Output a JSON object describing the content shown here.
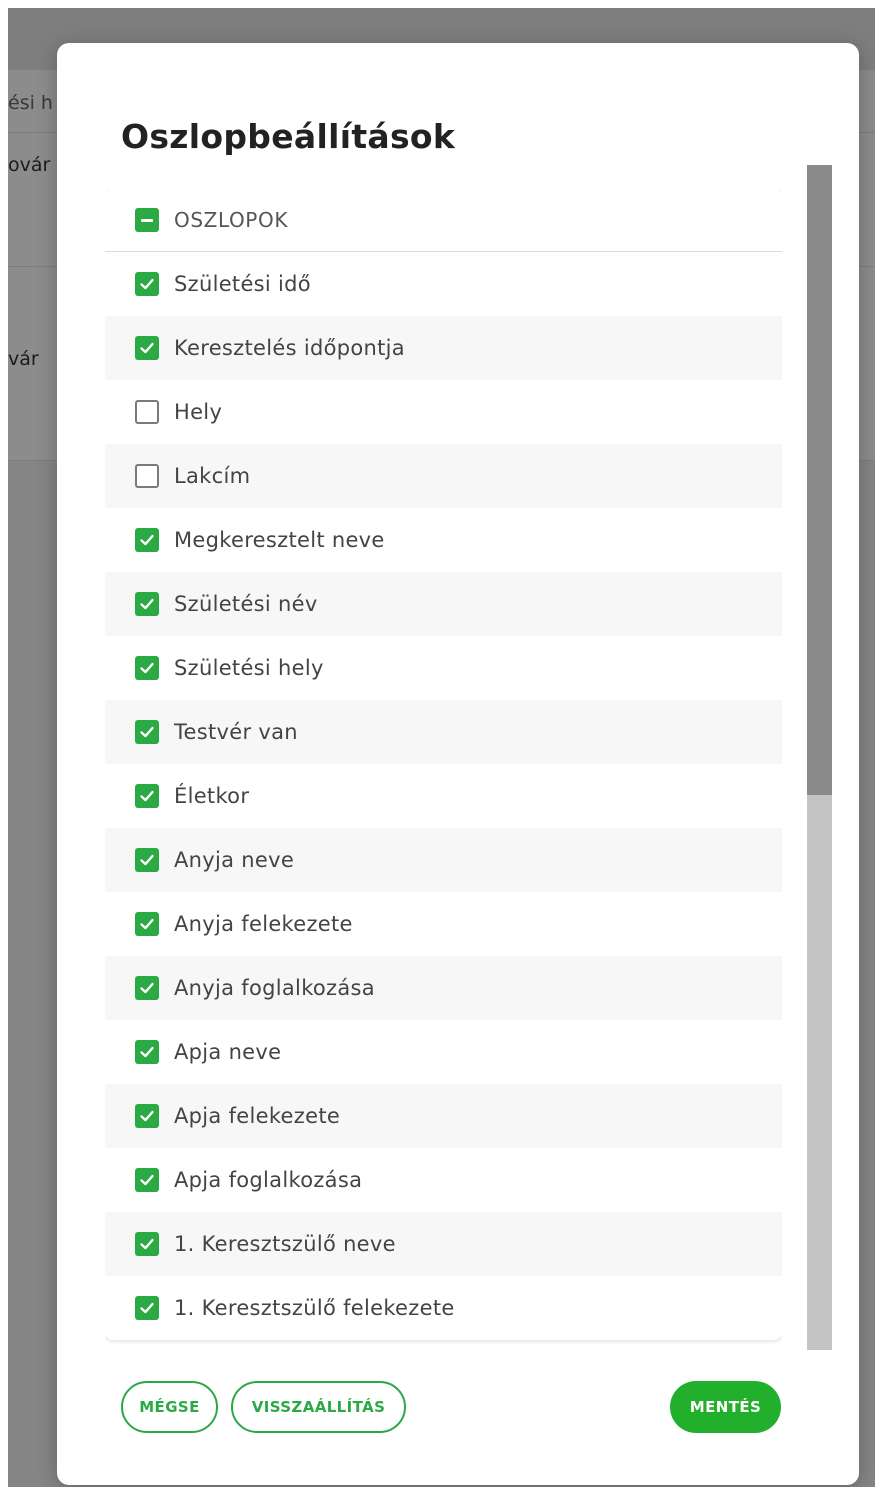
{
  "background": {
    "header_fragment": "ési h",
    "row_fragments": [
      "ovár",
      "vár"
    ]
  },
  "modal": {
    "title": "Oszlopbeállítások",
    "header": {
      "label": "OSZLOPOK",
      "state": "indeterminate"
    },
    "columns": [
      {
        "label": "Születési idő",
        "checked": true
      },
      {
        "label": "Keresztelés időpontja",
        "checked": true
      },
      {
        "label": "Hely",
        "checked": false
      },
      {
        "label": "Lakcím",
        "checked": false
      },
      {
        "label": "Megkeresztelt neve",
        "checked": true
      },
      {
        "label": "Születési név",
        "checked": true
      },
      {
        "label": "Születési hely",
        "checked": true
      },
      {
        "label": "Testvér van",
        "checked": true
      },
      {
        "label": "Életkor",
        "checked": true
      },
      {
        "label": "Anyja neve",
        "checked": true
      },
      {
        "label": "Anyja felekezete",
        "checked": true
      },
      {
        "label": "Anyja foglalkozása",
        "checked": true
      },
      {
        "label": "Apja neve",
        "checked": true
      },
      {
        "label": "Apja felekezete",
        "checked": true
      },
      {
        "label": "Apja foglalkozása",
        "checked": true
      },
      {
        "label": "1. Keresztszülő neve",
        "checked": true
      },
      {
        "label": "1. Keresztszülő felekezete",
        "checked": true
      }
    ],
    "buttons": {
      "cancel": "MÉGSE",
      "reset": "VISSZAÁLLÍTÁS",
      "save": "MENTÉS"
    }
  },
  "colors": {
    "accent": "#2ba944",
    "save_button": "#22b02c",
    "overlay": "rgba(0,0,0,0.45)"
  },
  "icons": {
    "checked": "check-icon",
    "indeterminate": "minus-icon"
  }
}
